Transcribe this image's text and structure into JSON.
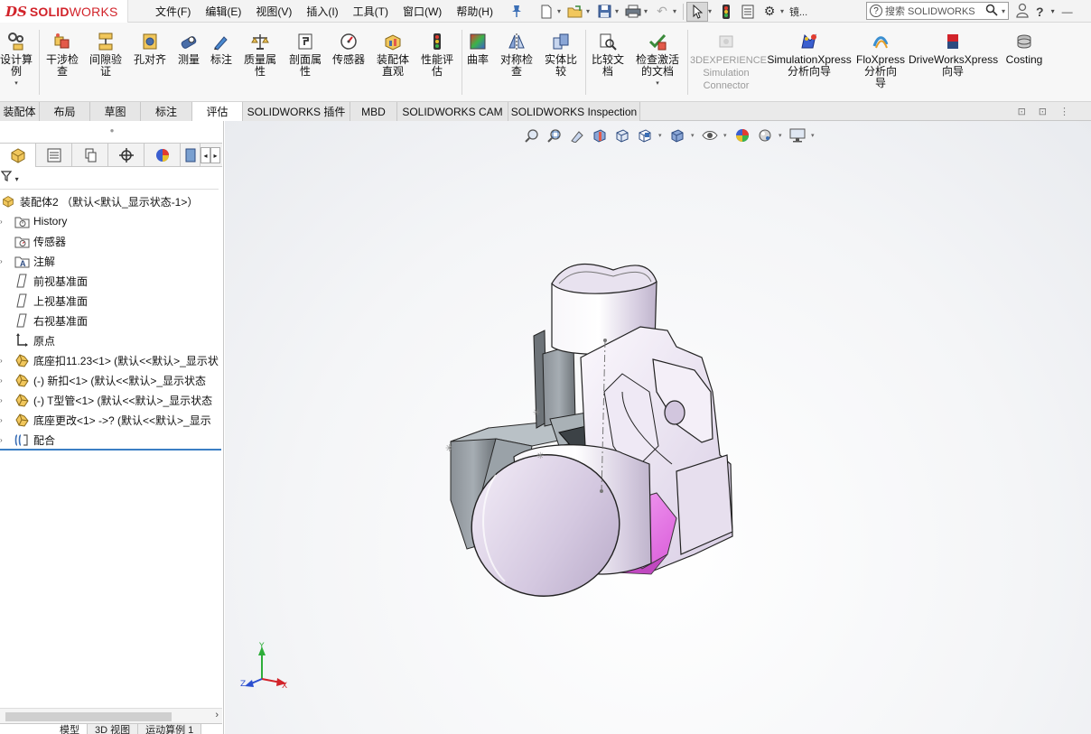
{
  "app": {
    "logo_prefix": "DS",
    "logo_solid": "SOLID",
    "logo_works": "WORKS"
  },
  "menu": [
    "文件(F)",
    "编辑(E)",
    "视图(V)",
    "插入(I)",
    "工具(T)",
    "窗口(W)",
    "帮助(H)"
  ],
  "search": {
    "placeholder": "搜索 SOLIDWORKS"
  },
  "toolbar_overflow_label": "镜...",
  "command_manager": [
    {
      "label": "设计算\n例",
      "icon": "design-study-icon"
    },
    {
      "label": "干涉检\n查",
      "icon": "interference-check-icon"
    },
    {
      "label": "间隙验\n证",
      "icon": "clearance-verification-icon"
    },
    {
      "label": "孔对齐",
      "icon": "hole-alignment-icon"
    },
    {
      "label": "测量",
      "icon": "measure-icon"
    },
    {
      "label": "标注",
      "icon": "markup-icon"
    },
    {
      "label": "质量属\n性",
      "icon": "mass-properties-icon"
    },
    {
      "label": "剖面属\n性",
      "icon": "section-properties-icon"
    },
    {
      "label": "传感器",
      "icon": "sensor-icon"
    },
    {
      "label": "装配体\n直观",
      "icon": "assembly-visualization-icon"
    },
    {
      "label": "性能评\n估",
      "icon": "performance-evaluation-icon"
    },
    {
      "label": "曲率",
      "icon": "curvature-icon"
    },
    {
      "label": "对称检\n查",
      "icon": "symmetry-check-icon"
    },
    {
      "label": "实体比\n较",
      "icon": "body-compare-icon"
    },
    {
      "label": "比较文\n档",
      "icon": "compare-documents-icon"
    },
    {
      "label": "检查激活\n的文档",
      "icon": "check-active-document-icon"
    },
    {
      "label": "3DEXPERIENCE\nSimulation\nConnector",
      "icon": "3dexperience-icon"
    },
    {
      "label": "SimulationXpress\n分析向导",
      "icon": "simulationxpress-icon"
    },
    {
      "label": "FloXpress\n分析向\n导",
      "icon": "floxpress-icon"
    },
    {
      "label": "DriveWorksXpress\n向导",
      "icon": "driveworksxpress-icon"
    },
    {
      "label": "Costing",
      "icon": "costing-icon"
    }
  ],
  "tabs": [
    "装配体",
    "布局",
    "草图",
    "标注",
    "评估",
    "SOLIDWORKS 插件",
    "MBD",
    "SOLIDWORKS CAM",
    "SOLIDWORKS Inspection"
  ],
  "active_tab": "评估",
  "tree": {
    "root": "装配体2 （默认<默认_显示状态-1>）",
    "items": [
      {
        "label": "History",
        "icon": "history-folder-icon",
        "expandable": true
      },
      {
        "label": "传感器",
        "icon": "sensor-folder-icon",
        "expandable": false
      },
      {
        "label": "注解",
        "icon": "annotations-icon",
        "expandable": true
      },
      {
        "label": "前视基准面",
        "icon": "plane-icon",
        "expandable": false
      },
      {
        "label": "上视基准面",
        "icon": "plane-icon",
        "expandable": false
      },
      {
        "label": "右视基准面",
        "icon": "plane-icon",
        "expandable": false
      },
      {
        "label": "原点",
        "icon": "origin-icon",
        "expandable": false
      },
      {
        "label": "底座扣11.23<1> (默认<<默认>_显示状",
        "icon": "part-icon",
        "expandable": true
      },
      {
        "label": "(-) 新扣<1> (默认<<默认>_显示状态",
        "icon": "part-icon",
        "expandable": true
      },
      {
        "label": "(-) T型管<1> (默认<<默认>_显示状态",
        "icon": "part-icon",
        "expandable": true
      },
      {
        "label": "底座更改<1> ->? (默认<<默认>_显示",
        "icon": "part-icon",
        "expandable": true
      },
      {
        "label": "配合",
        "icon": "mates-icon",
        "expandable": true
      }
    ]
  },
  "bottom_tabs": [
    "模型",
    "3D 视图",
    "运动算例 1"
  ],
  "triad": {
    "x": "X",
    "y": "Y",
    "z": "Z"
  },
  "colors": {
    "accent_red": "#d2232a",
    "selection_blue": "#3b7fc4",
    "part_silver": "#d9d2e0",
    "highlight_magenta": "#e87ae8",
    "dark_metal": "#6d7378"
  }
}
